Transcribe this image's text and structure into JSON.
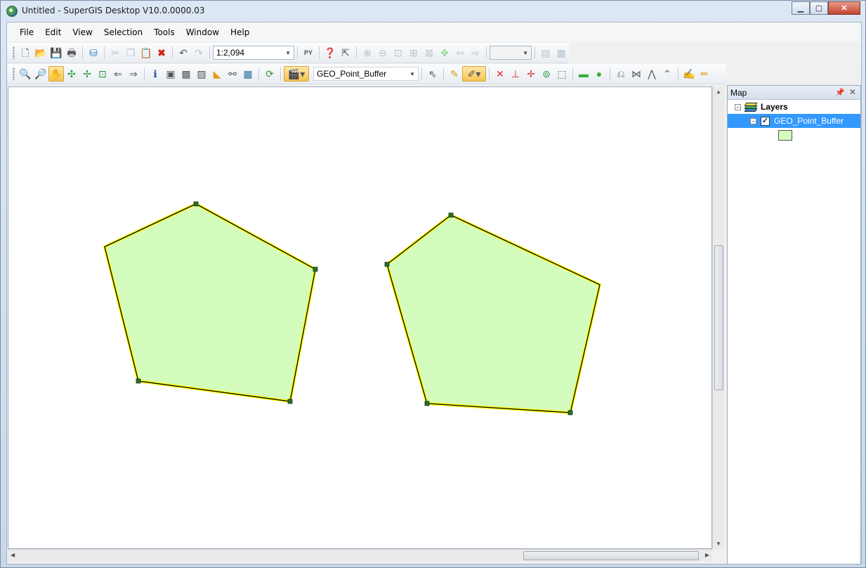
{
  "window": {
    "title": "Untitled - SuperGIS Desktop V10.0.0000.03"
  },
  "menu": [
    "File",
    "Edit",
    "View",
    "Selection",
    "Tools",
    "Window",
    "Help"
  ],
  "toolbar": {
    "scale_value": "1:2,094",
    "target_layer": "GEO_Point_Buffer",
    "zoom_value": ""
  },
  "map": {
    "fill_color": "#d3fcbd",
    "outline_color": "#000000",
    "highlight_color": "#ffff00",
    "vertex_color": "#2f6b2f"
  },
  "panel": {
    "title": "Map",
    "root_label": "Layers",
    "layer_label": "GEO_Point_Buffer",
    "layer_checked": true
  },
  "icons": [
    "new-icon",
    "open-icon",
    "save-icon",
    "print-icon",
    "add-data-icon",
    "cut-icon",
    "copy-icon",
    "paste-icon",
    "delete-icon",
    "undo-icon",
    "redo-icon",
    "python-icon",
    "help-icon",
    "whats-this-icon",
    "zoom-in-icon",
    "zoom-out-icon",
    "pan-icon",
    "full-extent-icon",
    "identify-icon",
    "select-icon",
    "editor-icon",
    "pencil-icon"
  ]
}
